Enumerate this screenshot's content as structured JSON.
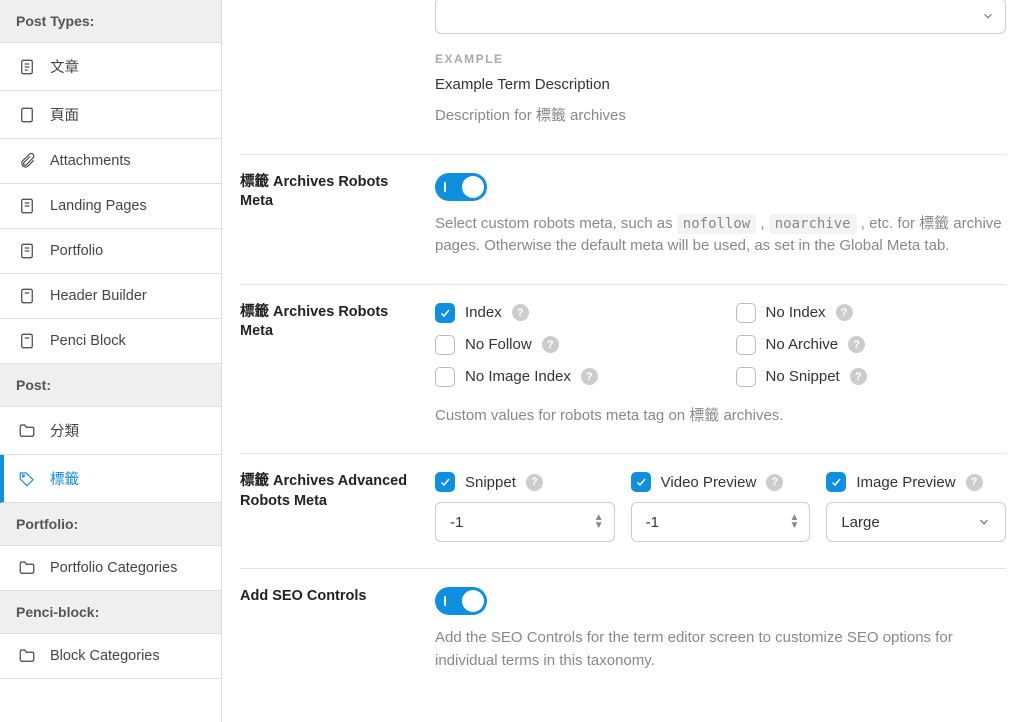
{
  "sidebar": {
    "group_post_types": "Post Types:",
    "items_post_types": [
      {
        "label": "文章"
      },
      {
        "label": "頁面"
      },
      {
        "label": "Attachments"
      },
      {
        "label": "Landing Pages"
      },
      {
        "label": "Portfolio"
      },
      {
        "label": "Header Builder"
      },
      {
        "label": "Penci Block"
      }
    ],
    "group_post": "Post:",
    "items_post": [
      {
        "label": "分類"
      },
      {
        "label": "標籤"
      }
    ],
    "group_portfolio": "Portfolio:",
    "items_portfolio": [
      {
        "label": "Portfolio Categories"
      }
    ],
    "group_penci": "Penci-block:",
    "items_penci": [
      {
        "label": "Block Categories"
      }
    ]
  },
  "desc_block": {
    "example_label": "EXAMPLE",
    "example_title": "Example Term Description",
    "desc": "Description for 標籤 archives"
  },
  "robots1": {
    "label": "標籤 Archives Robots Meta",
    "desc_a": "Select custom robots meta, such as ",
    "code1": "nofollow",
    "desc_b": " , ",
    "code2": "noarchive",
    "desc_c": " , etc. for 標籤 archive pages. Otherwise the default meta will be used, as set in the Global Meta tab."
  },
  "robots2": {
    "label": "標籤 Archives Robots Meta",
    "options": [
      {
        "label": "Index",
        "checked": true
      },
      {
        "label": "No Index",
        "checked": false
      },
      {
        "label": "No Follow",
        "checked": false
      },
      {
        "label": "No Archive",
        "checked": false
      },
      {
        "label": "No Image Index",
        "checked": false
      },
      {
        "label": "No Snippet",
        "checked": false
      }
    ],
    "hint": "Custom values for robots meta tag on 標籤 archives."
  },
  "advanced": {
    "label": "標籤 Archives Advanced Robots Meta",
    "cols": [
      {
        "label": "Snippet",
        "value": "-1",
        "type": "number"
      },
      {
        "label": "Video Preview",
        "value": "-1",
        "type": "number"
      },
      {
        "label": "Image Preview",
        "value": "Large",
        "type": "select"
      }
    ]
  },
  "seo": {
    "label": "Add SEO Controls",
    "desc": "Add the SEO Controls for the term editor screen to customize SEO options for individual terms in this taxonomy."
  }
}
